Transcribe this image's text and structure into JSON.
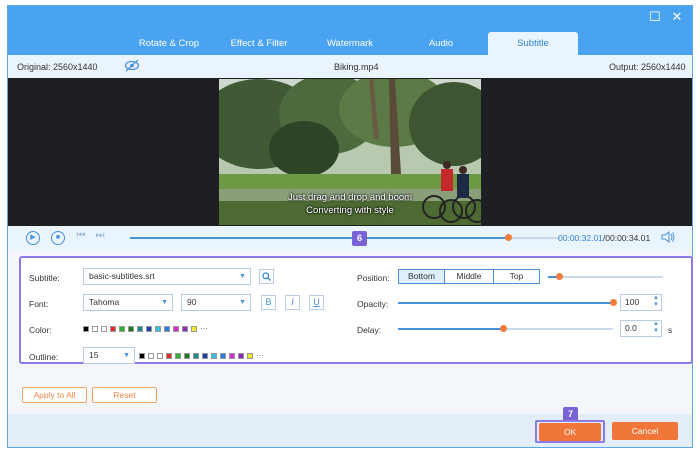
{
  "window": {
    "minimize_glyph": "☐",
    "close_glyph": "✕"
  },
  "tabs": [
    {
      "label": "Rotate & Crop"
    },
    {
      "label": "Effect & Filter"
    },
    {
      "label": "Watermark"
    },
    {
      "label": "Audio"
    },
    {
      "label": "Subtitle"
    }
  ],
  "infobar": {
    "original": "Original: 2560x1440",
    "filename": "Biking.mp4",
    "output": "Output: 2560x1440"
  },
  "preview": {
    "subtitle_line1": "Just drag and drop and boom",
    "subtitle_line2": "Converting with style"
  },
  "playback": {
    "current_time": "00:00:32.01",
    "total_time": "/00:00:34.01",
    "progress": 0.88
  },
  "badges": {
    "step6": "6",
    "step7": "7"
  },
  "subtitle_panel": {
    "subtitle_label": "Subtitle:",
    "subtitle_file": "basic-subtitles.srt",
    "font_label": "Font:",
    "font_name": "Tahoma",
    "font_size": "90",
    "bold": "B",
    "italic": "I",
    "underline": "U",
    "color_label": "Color:",
    "outline_label": "Outline:",
    "outline_value": "15",
    "position_label": "Position:",
    "positions": [
      "Bottom",
      "Middle",
      "Top"
    ],
    "selected_position": "Bottom",
    "position_level": 0.1,
    "opacity_label": "Opacity:",
    "opacity_value": "100",
    "opacity_level": 1.0,
    "delay_label": "Delay:",
    "delay_value": "0.0",
    "delay_unit": "s",
    "delay_level": 0.49,
    "swatch_colors": [
      "#000000",
      "#ffffff",
      "#ffffff",
      "#e52a2a",
      "#2ab52a",
      "#1b7a1b",
      "#1a8a8a",
      "#1c3fa8",
      "#35c0e0",
      "#2a7de0",
      "#d42ad4",
      "#8a2ab5",
      "#f0e62a"
    ],
    "more": "···"
  },
  "buttons": {
    "apply_to_all": "Apply to All",
    "reset": "Reset",
    "ok": "OK",
    "cancel": "Cancel"
  },
  "colors": {
    "accent": "#4aa3f0",
    "orange": "#f0763a",
    "highlight": "#8c7ae6"
  }
}
